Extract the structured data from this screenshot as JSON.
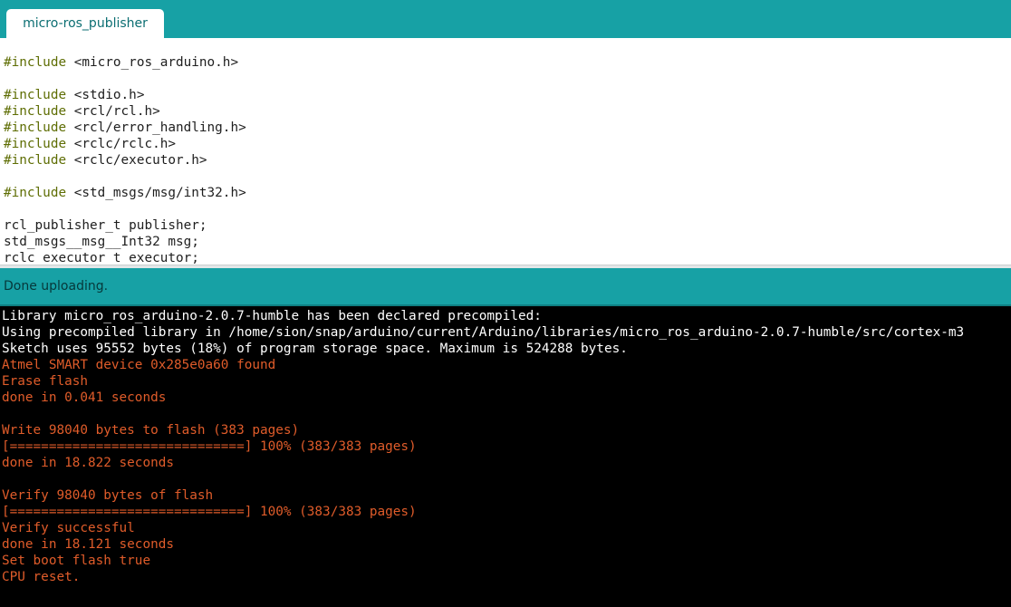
{
  "tab": {
    "label": "micro-ros_publisher"
  },
  "editor": {
    "lines": [
      {
        "kw": "#include",
        "rest": " <micro_ros_arduino.h>"
      },
      {
        "kw": "",
        "rest": ""
      },
      {
        "kw": "#include",
        "rest": " <stdio.h>"
      },
      {
        "kw": "#include",
        "rest": " <rcl/rcl.h>"
      },
      {
        "kw": "#include",
        "rest": " <rcl/error_handling.h>"
      },
      {
        "kw": "#include",
        "rest": " <rclc/rclc.h>"
      },
      {
        "kw": "#include",
        "rest": " <rclc/executor.h>"
      },
      {
        "kw": "",
        "rest": ""
      },
      {
        "kw": "#include",
        "rest": " <std_msgs/msg/int32.h>"
      },
      {
        "kw": "",
        "rest": ""
      },
      {
        "kw": "",
        "rest": "rcl_publisher_t publisher;"
      },
      {
        "kw": "",
        "rest": "std_msgs__msg__Int32 msg;"
      },
      {
        "kw": "",
        "rest": "rclc_executor_t executor;"
      }
    ]
  },
  "status": {
    "text": "Done uploading."
  },
  "console": {
    "lines": [
      {
        "text": "Library micro_ros_arduino-2.0.7-humble has been declared precompiled:",
        "style": "white"
      },
      {
        "text": "Using precompiled library in /home/sion/snap/arduino/current/Arduino/libraries/micro_ros_arduino-2.0.7-humble/src/cortex-m3",
        "style": "white"
      },
      {
        "text": "Sketch uses 95552 bytes (18%) of program storage space. Maximum is 524288 bytes.",
        "style": "white"
      },
      {
        "text": "Atmel SMART device 0x285e0a60 found",
        "style": "red"
      },
      {
        "text": "Erase flash",
        "style": "red"
      },
      {
        "text": "done in 0.041 seconds",
        "style": "red"
      },
      {
        "text": "",
        "style": "red"
      },
      {
        "text": "Write 98040 bytes to flash (383 pages)",
        "style": "red"
      },
      {
        "text": "[==============================] 100% (383/383 pages)",
        "style": "red"
      },
      {
        "text": "done in 18.822 seconds",
        "style": "red"
      },
      {
        "text": "",
        "style": "red"
      },
      {
        "text": "Verify 98040 bytes of flash",
        "style": "red"
      },
      {
        "text": "[==============================] 100% (383/383 pages)",
        "style": "red"
      },
      {
        "text": "Verify successful",
        "style": "red"
      },
      {
        "text": "done in 18.121 seconds",
        "style": "red"
      },
      {
        "text": "Set boot flash true",
        "style": "red"
      },
      {
        "text": "CPU reset.",
        "style": "red"
      }
    ]
  },
  "colors": {
    "accent": "#17a1a5",
    "keyword": "#5e6d03",
    "console_error": "#e05c2a",
    "console_info": "#ffffff"
  }
}
